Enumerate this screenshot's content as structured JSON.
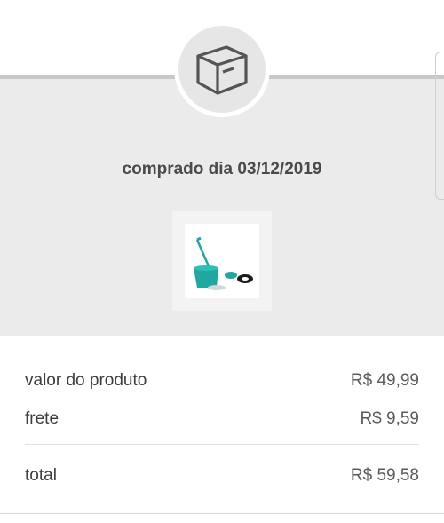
{
  "order": {
    "purchase_date_text": "comprado dia 03/12/2019",
    "header_icon": "box-icon",
    "product_image": "spin-mop-bucket-product"
  },
  "summary": {
    "product_label": "valor do produto",
    "product_value": "R$ 49,99",
    "shipping_label": "frete",
    "shipping_value": "R$ 9,59",
    "total_label": "total",
    "total_value": "R$ 59,58"
  },
  "colors": {
    "panel_bg": "#ebebeb",
    "icon_stroke": "#555555",
    "product_teal": "#1fa8a0"
  }
}
